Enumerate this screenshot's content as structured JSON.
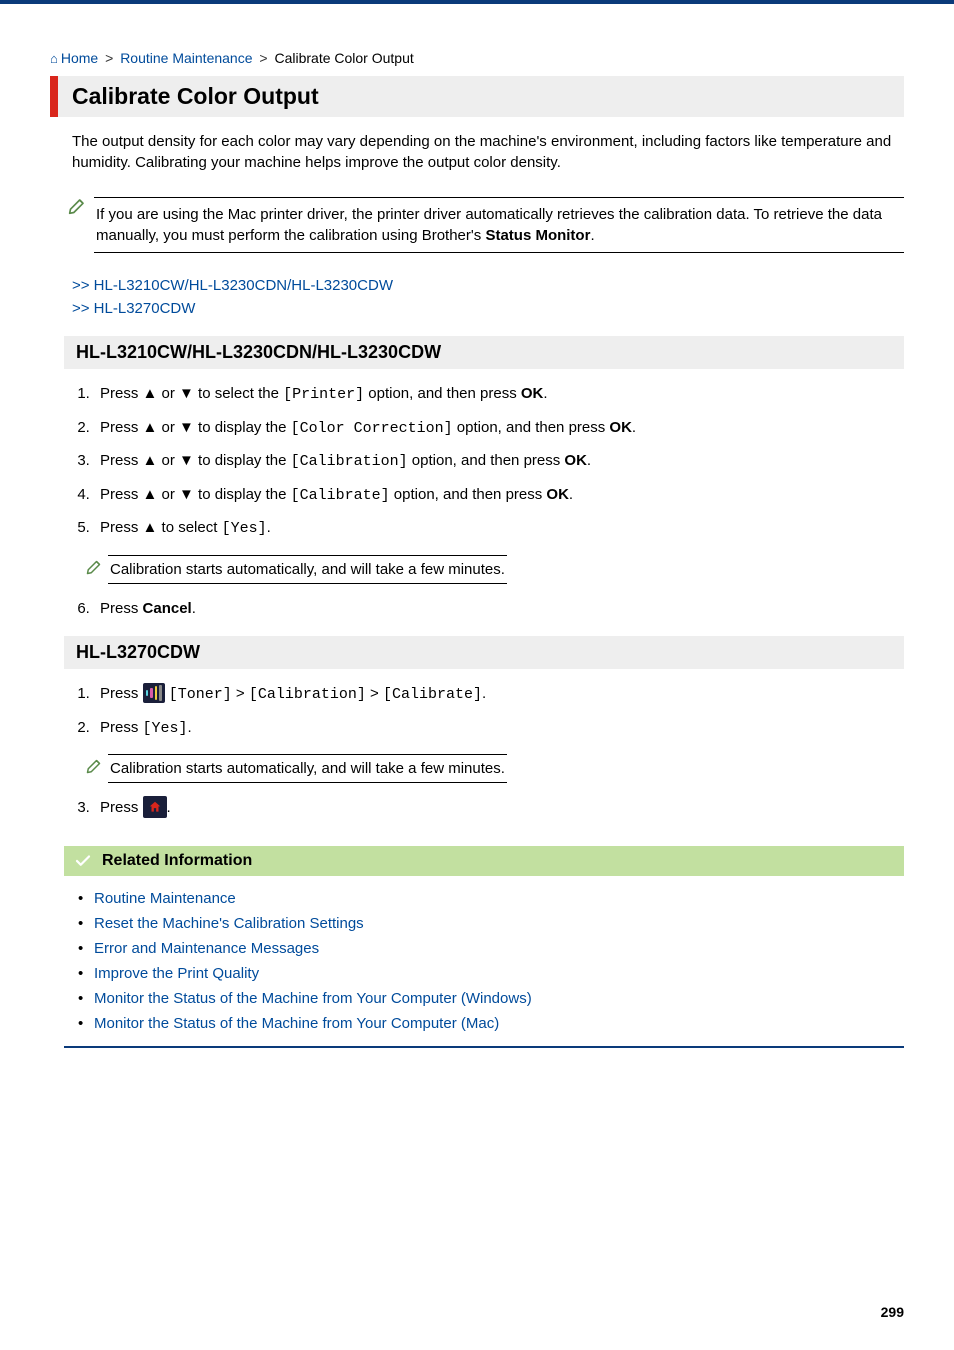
{
  "breadcrumb": {
    "home": "Home",
    "parent": "Routine Maintenance",
    "current": "Calibrate Color Output"
  },
  "title": "Calibrate Color Output",
  "intro": "The output density for each color may vary depending on the machine's environment, including factors like temperature and humidity. Calibrating your machine helps improve the output color density.",
  "note1_pre": "If you are using the Mac printer driver, the printer driver automatically retrieves the calibration data. To retrieve the data manually, you must perform the calibration using Brother's ",
  "note1_bold": "Status Monitor",
  "note1_post": ".",
  "anchor1": ">> HL-L3210CW/HL-L3230CDN/HL-L3230CDW",
  "anchor2": ">> HL-L3270CDW",
  "section1": {
    "title": "HL-L3210CW/HL-L3230CDN/HL-L3230CDW",
    "step1": {
      "pre": "Press ▲ or ▼ to select the ",
      "code": "[Printer]",
      "mid": " option, and then press ",
      "ok": "OK",
      "post": "."
    },
    "step2": {
      "pre": "Press ▲ or ▼ to display the ",
      "code": "[Color Correction]",
      "mid": " option, and then press ",
      "ok": "OK",
      "post": "."
    },
    "step3": {
      "pre": "Press ▲ or ▼ to display the ",
      "code": "[Calibration]",
      "mid": " option, and then press ",
      "ok": "OK",
      "post": "."
    },
    "step4": {
      "pre": "Press ▲ or ▼ to display the ",
      "code": "[Calibrate]",
      "mid": " option, and then press ",
      "ok": "OK",
      "post": "."
    },
    "step5": {
      "pre": "Press ▲ to select ",
      "code": "[Yes]",
      "post": "."
    },
    "note": "Calibration starts automatically, and will take a few minutes.",
    "step6": {
      "pre": "Press ",
      "bold": "Cancel",
      "post": "."
    }
  },
  "section2": {
    "title": "HL-L3270CDW",
    "step1": {
      "pre": "Press ",
      "code1": "[Toner]",
      "gt1": " > ",
      "code2": "[Calibration]",
      "gt2": " > ",
      "code3": "[Calibrate]",
      "post": "."
    },
    "step2": {
      "pre": "Press ",
      "code": "[Yes]",
      "post": "."
    },
    "note": "Calibration starts automatically, and will take a few minutes.",
    "step3": {
      "pre": "Press ",
      "post": "."
    }
  },
  "related": {
    "title": "Related Information",
    "items": [
      "Routine Maintenance",
      "Reset the Machine's Calibration Settings",
      "Error and Maintenance Messages",
      "Improve the Print Quality",
      "Monitor the Status of the Machine from Your Computer (Windows)",
      "Monitor the Status of the Machine from Your Computer (Mac)"
    ]
  },
  "pagenum": "299"
}
